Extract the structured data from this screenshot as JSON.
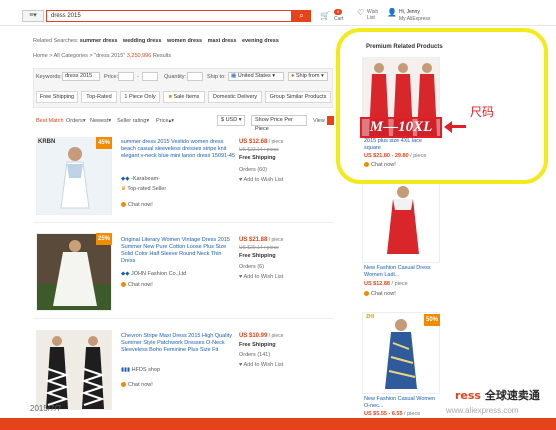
{
  "header": {
    "menu_icon": "hamburger-icon",
    "search_value": "dress 2015",
    "search_icon": "search-icon",
    "cart_label": "Cart",
    "cart_count": "0",
    "wish_label": "Wish\nList",
    "account_greeting": "Hi, Jenny",
    "account_label": "My AliExpress"
  },
  "related": {
    "prefix": "Related Searches:",
    "terms": [
      "summer dress",
      "wedding dress",
      "women dress",
      "maxi dress",
      "evening dress"
    ]
  },
  "breadcrumb": {
    "home": "Home",
    "sep1": " > ",
    "all": "All Categories",
    "sep2": " > ",
    "query": "\"dress 2015\"",
    "count": " 3,250,996",
    "suffix": " Results"
  },
  "filters": {
    "keywords_label": "Keywords:",
    "keywords_value": "dress 2015",
    "price_label": "Price:",
    "dash": "-",
    "quantity_label": "Quantity:",
    "ship_to_label": "Ship to:",
    "ship_to_value": "United States",
    "ship_from_value": "Ship from",
    "chips": [
      "Free Shipping",
      "Top-Rated",
      "1 Piece Only",
      "Sale Items",
      "Domestic Delivery",
      "Group Similar Products"
    ]
  },
  "sort": {
    "best_match": "Best Match",
    "orders": "Orders",
    "newest": "Newest",
    "seller_rating": "Seller rating",
    "price": "Price",
    "currency": "$ USD",
    "show_price_per_piece": "Show Price Per Piece",
    "view": "View"
  },
  "products": [
    {
      "discount": "45%",
      "title": "summer dress 2015 Vestido women dress beach casual sleeveless dresses stripe knit elegant v-neck blue mini lanon dress 15091-45",
      "seller": "-Karabeam-",
      "badge": "Top-rated Seller",
      "chat": "Chat now!",
      "price": "US $12.68",
      "per": " / piece",
      "old_price": "US $23.14 / piece",
      "shipping": "Free Shipping",
      "orders": "Orders (60)",
      "wish": "Add to Wish List",
      "brand": "KRBN"
    },
    {
      "discount": "25%",
      "title": "Original Literary Women Vintage Dress 2015 Summer New Pure Cotton Loose Plus Size Solid Color Half Sleeve Round Neck Thin Dress",
      "seller": "JOHN Fashion Co.,Ltd",
      "chat": "Chat now!",
      "price": "US $21.88",
      "per": " / piece",
      "old_price": "US $29.14 / piece",
      "shipping": "Free Shipping",
      "orders": "Orders (6)",
      "wish": "Add to Wish List"
    },
    {
      "title": "Chevron Stripe Maxi Dress 2015 High Quality Summer Style Patchwork Dresses O-Neck Sleeveless Boho Feminine Plus Size Fit",
      "seller": "HFDS shop",
      "chat": "Chat now!",
      "price": "US $10.99",
      "per": " / piece",
      "shipping": "Free Shipping",
      "orders": "Orders (141)",
      "wish": "Add to Wish List"
    }
  ],
  "sidebar": {
    "title": "Premium Related Products",
    "items": [
      {
        "title": "2015 plus size 4XL lace square",
        "price": "US $21.80 - 29.80",
        "per": " / piece",
        "chat": "Chat now!"
      },
      {
        "title": "New Fashion Casual Dress Women Ladi...",
        "price": "US $12.88",
        "per": " / piece",
        "chat": "Chat now!"
      },
      {
        "discount": "50%",
        "title": "New Fashion Casual Women O-nec...",
        "price": "US $5.55 - 6.55",
        "per": " / piece",
        "chat": "Chat now!"
      }
    ]
  },
  "annotation": {
    "size_range": "M—10XL",
    "label": "尺码"
  },
  "footer": {
    "date": "2015/7/7",
    "banner_prefix": "ress",
    "banner_cn": "全球速卖通",
    "url": "www.aliexpress.com"
  },
  "colors": {
    "accent": "#e5431a",
    "highlight": "#f3ea1c",
    "annotation_red": "#e21f26",
    "link": "#1a5fb4"
  }
}
